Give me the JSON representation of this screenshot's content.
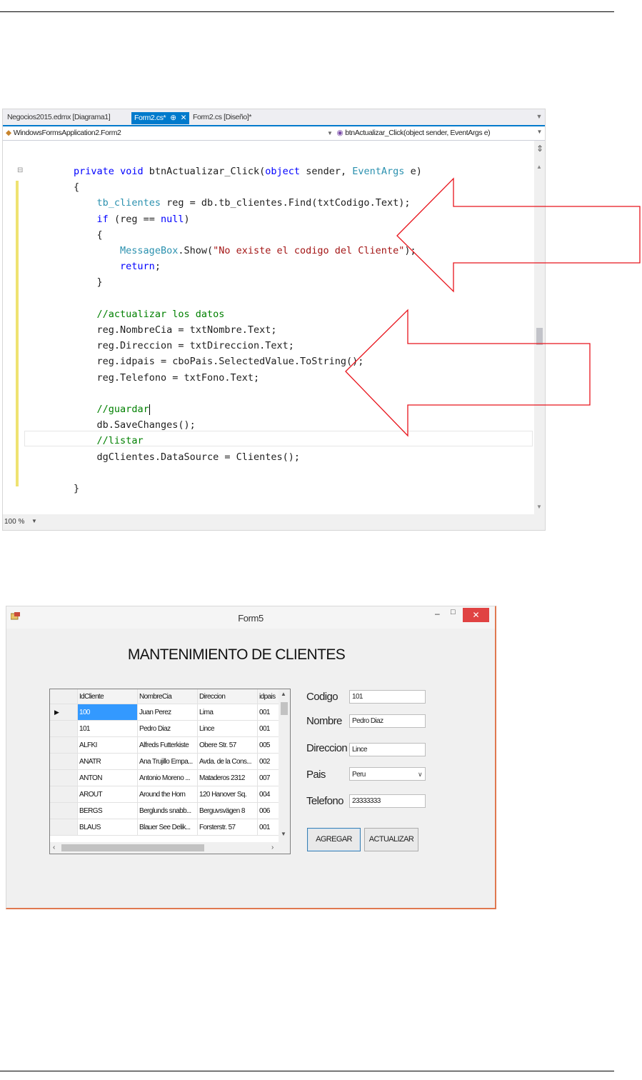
{
  "ide": {
    "tabs": [
      {
        "label": "Negocios2015.edmx [Diagrama1]"
      },
      {
        "label": "Form2.cs*",
        "pin": "⊕",
        "close": "✕"
      },
      {
        "label": "Form2.cs [Diseño]*"
      }
    ],
    "nav_left": "WindowsFormsApplication2.Form2",
    "nav_right": "btnActualizar_Click(object sender, EventArgs e)",
    "zoom": "100 %",
    "code": {
      "l1_kw1": "private",
      "l1_kw2": "void",
      "l1_name": "btnActualizar_Click(",
      "l1_kw3": "object",
      "l1_mid": "sender,",
      "l1_type": "EventArgs",
      "l1_end": "e)",
      "l2": "{",
      "l3_type": "tb_clientes",
      "l3_rest": "reg = db.tb_clientes.Find(txtCodigo.Text);",
      "l4_kw": "if",
      "l4_a": "(reg ==",
      "l4_null": "null",
      "l4_b": ")",
      "l5": "{",
      "l6_type": "MessageBox",
      "l6_a": ".Show(",
      "l6_str": "\"No existe el codigo del Cliente\"",
      "l6_b": ");",
      "l7_kw": "return",
      "l7_b": ";",
      "l8": "}",
      "l10": "//actualizar los datos",
      "l11": "reg.NombreCia = txtNombre.Text;",
      "l12": "reg.Direccion = txtDireccion.Text;",
      "l13": "reg.idpais = cboPais.SelectedValue.ToString();",
      "l14": "reg.Telefono = txtFono.Text;",
      "l16": "//guardar",
      "l17": "db.SaveChanges();",
      "l18": "//listar",
      "l19": "dgClientes.DataSource = Clientes();",
      "l21": "}"
    }
  },
  "form": {
    "title": "Form5",
    "heading": "MANTENIMIENTO DE CLIENTES",
    "grid": {
      "headers": [
        "IdCliente",
        "NombreCia",
        "Direccion",
        "idpais"
      ],
      "rows": [
        [
          "100",
          "Juan Perez",
          "Lima",
          "001"
        ],
        [
          "101",
          "Pedro Diaz",
          "Lince",
          "001"
        ],
        [
          "ALFKI",
          "Alfreds Futterkiste",
          "Obere Str. 57",
          "005"
        ],
        [
          "ANATR",
          "Ana Trujillo Empa...",
          "Avda. de la Cons...",
          "002"
        ],
        [
          "ANTON",
          "Antonio Moreno ...",
          "Mataderos  2312",
          "007"
        ],
        [
          "AROUT",
          "Around the Horn",
          "120 Hanover Sq.",
          "004"
        ],
        [
          "BERGS",
          "Berglunds snabb...",
          "Berguvsvägen  8",
          "006"
        ],
        [
          "BLAUS",
          "Blauer See Delik...",
          "Forsterstr. 57",
          "001"
        ]
      ]
    },
    "fields": {
      "codigo_label": "Codigo",
      "codigo_value": "101",
      "nombre_label": "Nombre",
      "nombre_value": "Pedro Diaz",
      "direccion_label": "Direccion",
      "direccion_value": "Lince",
      "pais_label": "Pais",
      "pais_value": "Peru",
      "telefono_label": "Telefono",
      "telefono_value": "23333333"
    },
    "buttons": {
      "agregar": "AGREGAR",
      "actualizar": "ACTUALIZAR"
    }
  },
  "annotations": {
    "arrow_color": "#e8141c"
  }
}
